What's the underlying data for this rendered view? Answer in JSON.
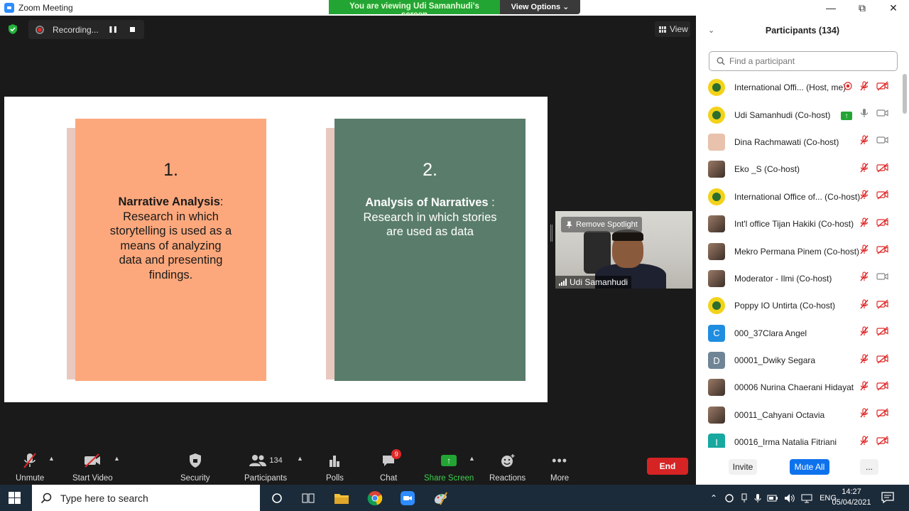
{
  "window": {
    "title": "Zoom Meeting",
    "viewing_banner": "You are viewing Udi Samanhudi's screen",
    "view_options": "View Options ⌄"
  },
  "stage": {
    "recording_label": "Recording...",
    "view_label": "View",
    "slide": {
      "card1": {
        "number": "1.",
        "bold": "Narrative Analysis",
        "rest": ": Research in which storytelling is used as a means of analyzing data and presenting findings."
      },
      "card2": {
        "number": "2.",
        "bold": "Analysis of Narratives",
        "rest": " : Research in which stories are used as data"
      }
    },
    "video": {
      "remove_spotlight": "Remove Spotlight",
      "name": "Udi Samanhudi"
    }
  },
  "toolbar": {
    "unmute": "Unmute",
    "start_video": "Start Video",
    "security": "Security",
    "participants": "Participants",
    "participants_count": "134",
    "polls": "Polls",
    "chat": "Chat",
    "chat_badge": "9",
    "share_screen": "Share Screen",
    "reactions": "Reactions",
    "more": "More",
    "end": "End"
  },
  "panel": {
    "title": "Participants (134)",
    "search_placeholder": "Find a participant",
    "participants": [
      {
        "name": "International Offi... (Host, me)",
        "avatar": "logo",
        "rec": true,
        "video": "off"
      },
      {
        "name": "Udi Samanhudi (Co-host)",
        "avatar": "logo",
        "sharing": true,
        "mic": "on",
        "video": "on"
      },
      {
        "name": "Dina Rachmawati (Co-host)",
        "avatar": "plain",
        "video": "on"
      },
      {
        "name": "Eko _S (Co-host)",
        "avatar": "photo",
        "video": "off"
      },
      {
        "name": "International Office of... (Co-host)",
        "avatar": "logo",
        "video": "off"
      },
      {
        "name": "Int'l office Tijan Hakiki (Co-host)",
        "avatar": "photo",
        "video": "off"
      },
      {
        "name": "Mekro Permana Pinem (Co-host)",
        "avatar": "photo",
        "video": "off"
      },
      {
        "name": "Moderator - Ilmi (Co-host)",
        "avatar": "photo",
        "video": "on"
      },
      {
        "name": "Poppy IO Untirta (Co-host)",
        "avatar": "logo",
        "video": "off"
      },
      {
        "name": "000_37Clara Angel",
        "avatar": "letter",
        "letter": "C",
        "color": "#1f8de0",
        "video": "off"
      },
      {
        "name": "00001_Dwiky Segara",
        "avatar": "letter",
        "letter": "D",
        "color": "#6f8596",
        "video": "off"
      },
      {
        "name": "00006 Nurina Chaerani Hidayat",
        "avatar": "photo",
        "video": "off"
      },
      {
        "name": "00011_Cahyani Octavia",
        "avatar": "photo",
        "video": "off"
      },
      {
        "name": "00016_Irma Natalia Fitriani",
        "avatar": "letter",
        "letter": "I",
        "color": "#17a8a0",
        "video": "off"
      }
    ],
    "invite": "Invite",
    "mute_all": "Mute All",
    "more": "..."
  },
  "taskbar": {
    "search_placeholder": "Type here to search",
    "lang": "ENG",
    "time": "14:27",
    "date": "05/04/2021"
  }
}
